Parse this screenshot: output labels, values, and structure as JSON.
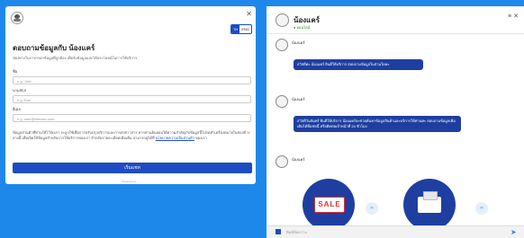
{
  "form": {
    "title": "ตอบถามข้อมูลกับ น้องแคร์",
    "subtitle": "ช่องทางในการกรอกข้อมูลที่ถูกต้อง เพื่อรับข้อมูลและได้ประโยชน์ในการใช้บริการ",
    "lang_options": [
      "TH",
      "ENG"
    ],
    "fields": [
      {
        "label": "ชื่อ",
        "placeholder": "e.g. John"
      },
      {
        "label": "นามสกุล",
        "placeholder": "e.g. Doe"
      },
      {
        "label": "อีเมล",
        "placeholder": "e.g. user@domain.com"
      }
    ],
    "consent_text": "ข้อมูลส่วนตัวที่ท่านให้ไว้กับเรา จะถูกใช้เพื่อการปรับปรุงบริการและการส่งข่าวสาร หากท่านยินยอมให้ความสำคัญกับข้อมูลนี้โปรดทำเครื่องหมายในช่องข้างล่างนี้ เพื่อเปิดใช้ข้อมูลสำหรับการใช้บริการของเรา สำหรับรายละเอียดเพิ่มเติม สามารถดูได้ที่",
    "consent_link": "นโยบายความเป็นส่วนตัว",
    "consent_suffix": "ของเรา",
    "submit_label": "เริ่มแชท",
    "powered_by": "Powered by ..."
  },
  "chat": {
    "agent_name": "น้องแคร์",
    "agent_status": "● ออนไลน์",
    "messages": [
      {
        "sender": "น้องแคร์",
        "text": "สวัสดีค่ะ น้องแคร์ ยินดีให้บริการ สอบถามข้อมูลในส่วนใดคะ"
      },
      {
        "sender": "น้องแคร์",
        "text": "สวัสดีวันจันทร์ ยินดีให้บริการ น้องแคร์จะช่วยค้นหาข้อมูลสินค้าและบริการให้ท่านค่ะ สอบถามข้อมูลเพิ่มเติมได้ที่แชทนี้ หรือติดต่อเจ้าหน้าที่ 24 ชั่วโมง"
      }
    ],
    "trailing_sender": "น้องแคร์",
    "carousel": {
      "card1_label": "SALE"
    },
    "input_placeholder": "พิมพ์ข้อความ"
  }
}
